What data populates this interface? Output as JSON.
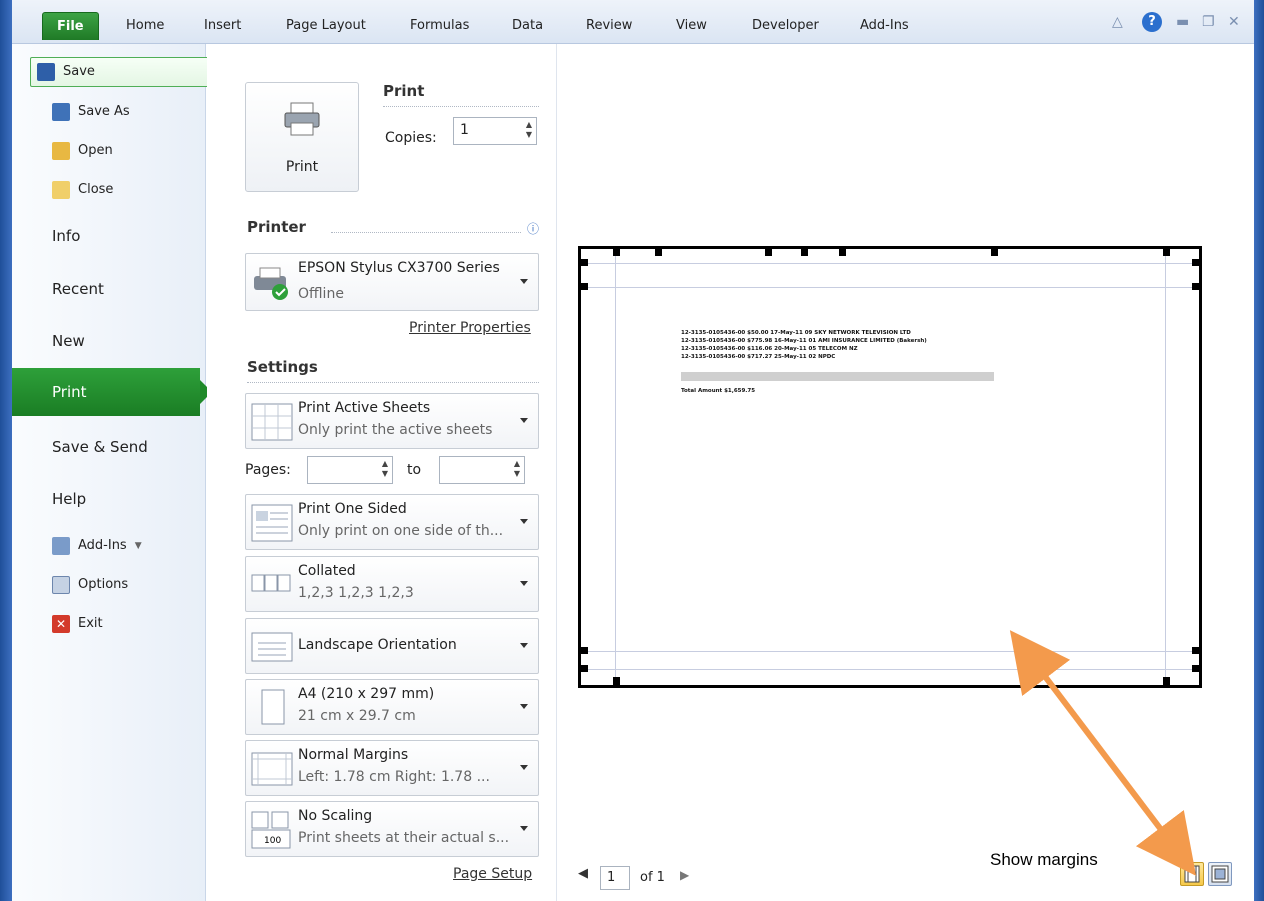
{
  "ribbon": {
    "tabs": [
      "File",
      "Home",
      "Insert",
      "Page Layout",
      "Formulas",
      "Data",
      "Review",
      "View",
      "Developer",
      "Add-Ins"
    ]
  },
  "nav": {
    "save": "Save",
    "save_as": "Save As",
    "open": "Open",
    "close": "Close",
    "info": "Info",
    "recent": "Recent",
    "new": "New",
    "print": "Print",
    "save_send": "Save & Send",
    "help": "Help",
    "addins": "Add-Ins",
    "options": "Options",
    "exit": "Exit"
  },
  "print": {
    "header": "Print",
    "button": "Print",
    "copies_label": "Copies:",
    "copies_value": "1"
  },
  "printer": {
    "header": "Printer",
    "name": "EPSON Stylus CX3700 Series",
    "status": "Offline",
    "properties_link": "Printer Properties"
  },
  "settings": {
    "header": "Settings",
    "active": {
      "title": "Print Active Sheets",
      "sub": "Only print the active sheets"
    },
    "pages_label": "Pages:",
    "to_label": "to",
    "pages_from": "",
    "pages_to": "",
    "sided": {
      "title": "Print One Sided",
      "sub": "Only print on one side of th..."
    },
    "collated": {
      "title": "Collated",
      "sub": "1,2,3   1,2,3   1,2,3"
    },
    "orientation": {
      "title": "Landscape Orientation"
    },
    "paper": {
      "title": "A4 (210 x 297 mm)",
      "sub": "21 cm x 29.7 cm"
    },
    "margins": {
      "title": "Normal Margins",
      "sub": "Left: 1.78 cm   Right: 1.78 ..."
    },
    "scaling": {
      "title": "No Scaling",
      "sub": "Print sheets at their actual s...",
      "icon_num": "100"
    },
    "page_setup_link": "Page Setup"
  },
  "preview": {
    "rows": [
      "12-3135-0105436-00      $50.00  17-May-11 09 SKY NETWORK TELEVISION LTD",
      "12-3135-0105436-00      $775.98  16-May-11 01 AMI INSURANCE LIMITED (Bakersh)",
      "12-3135-0105436-00      $116.06  20-May-11 05 TELECOM NZ",
      "12-3135-0105436-00      $717.27  25-May-11 02 NPDC"
    ],
    "total": "Total Amount          $1,659.75",
    "page_current": "1",
    "page_total": "of 1"
  },
  "annotation": {
    "show_margins": "Show margins"
  },
  "colors": {
    "accent_green": "#1f8a29",
    "arrow": "#f39a4c",
    "ribbon_blue": "#2b6fce"
  }
}
